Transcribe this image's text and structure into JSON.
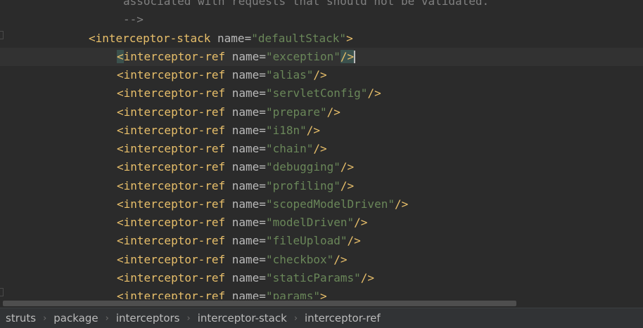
{
  "editor": {
    "lines": [
      {
        "kind": "comment",
        "text": "associated with requests that should not be validated."
      },
      {
        "kind": "comment",
        "text": "-->"
      },
      {
        "kind": "open",
        "tag": "<interceptor-stack",
        "attr": "name",
        "value": "\"defaultStack\"",
        "end": ">"
      },
      {
        "kind": "ref",
        "tag": "<interceptor-ref",
        "attr": "name",
        "value": "\"exception\"",
        "end": "/>",
        "current": true
      },
      {
        "kind": "ref",
        "tag": "<interceptor-ref",
        "attr": "name",
        "value": "\"alias\"",
        "end": "/>"
      },
      {
        "kind": "ref",
        "tag": "<interceptor-ref",
        "attr": "name",
        "value": "\"servletConfig\"",
        "end": "/>"
      },
      {
        "kind": "ref",
        "tag": "<interceptor-ref",
        "attr": "name",
        "value": "\"prepare\"",
        "end": "/>"
      },
      {
        "kind": "ref",
        "tag": "<interceptor-ref",
        "attr": "name",
        "value": "\"i18n\"",
        "end": "/>"
      },
      {
        "kind": "ref",
        "tag": "<interceptor-ref",
        "attr": "name",
        "value": "\"chain\"",
        "end": "/>"
      },
      {
        "kind": "ref",
        "tag": "<interceptor-ref",
        "attr": "name",
        "value": "\"debugging\"",
        "end": "/>"
      },
      {
        "kind": "ref",
        "tag": "<interceptor-ref",
        "attr": "name",
        "value": "\"profiling\"",
        "end": "/>"
      },
      {
        "kind": "ref",
        "tag": "<interceptor-ref",
        "attr": "name",
        "value": "\"scopedModelDriven\"",
        "end": "/>"
      },
      {
        "kind": "ref",
        "tag": "<interceptor-ref",
        "attr": "name",
        "value": "\"modelDriven\"",
        "end": "/>"
      },
      {
        "kind": "ref",
        "tag": "<interceptor-ref",
        "attr": "name",
        "value": "\"fileUpload\"",
        "end": "/>"
      },
      {
        "kind": "ref",
        "tag": "<interceptor-ref",
        "attr": "name",
        "value": "\"checkbox\"",
        "end": "/>"
      },
      {
        "kind": "ref",
        "tag": "<interceptor-ref",
        "attr": "name",
        "value": "\"staticParams\"",
        "end": "/>"
      },
      {
        "kind": "ref",
        "tag": "<interceptor-ref",
        "attr": "name",
        "value": "\"params\"",
        "end": ">"
      }
    ]
  },
  "breadcrumbs": {
    "items": [
      "struts",
      "package",
      "interceptors",
      "interceptor-stack",
      "interceptor-ref"
    ],
    "separator": "›"
  },
  "colors": {
    "background": "#2b2b2b",
    "tag": "#e8bf6a",
    "attribute": "#bababa",
    "value": "#6a8759",
    "comment": "#808080"
  }
}
